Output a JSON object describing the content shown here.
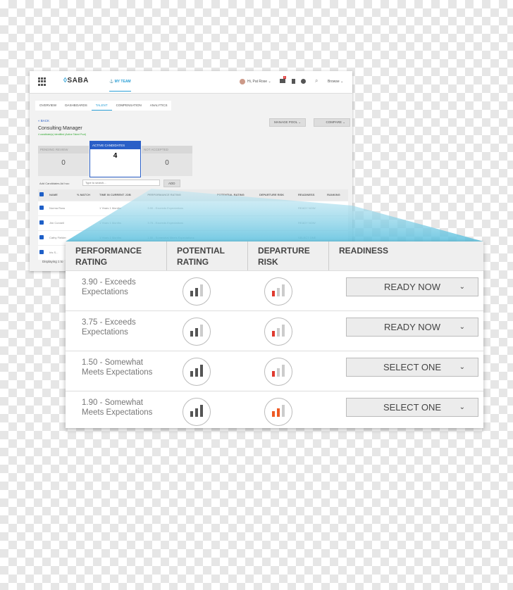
{
  "app": {
    "logo": "SABA",
    "nav_item": "MY TEAM",
    "user_greeting": "Hi, Pat Rose",
    "notification_count": "2",
    "browse": "Browse"
  },
  "tabs": [
    "OVERVIEW",
    "DASHBOARDS",
    "TALENT",
    "COMPENSATION",
    "ANALYTICS"
  ],
  "active_tab": "TALENT",
  "back": "« BACK",
  "title": "Consulting Manager",
  "subtitle": "4 candidate(s) identified (Active Talent Pool)",
  "manage_pool": "MANAGE POOL",
  "compare": "COMPARE",
  "cards": [
    {
      "label": "PENDING REVIEW",
      "count": "0"
    },
    {
      "label": "ACTIVE CANDIDATES",
      "count": "4"
    },
    {
      "label": "NOT ACCEPTED",
      "count": "0"
    }
  ],
  "add_label": "Add Candidates Ad hoc:",
  "search_placeholder": "Type to search...",
  "add_button": "ADD",
  "columns": [
    "NAME",
    "% MATCH",
    "TIME IN CURRENT JOB",
    "PERFORMANCE RATING",
    "POTENTIAL RATING",
    "DEPARTURE RISK",
    "READINESS",
    "RANKING"
  ],
  "rows": [
    {
      "name": "Norma Ross",
      "time": "1 Years 1 Months",
      "perf": "3.90 - Exceeds Expectations",
      "readiness": "READY NOW"
    },
    {
      "name": "Jim Connell",
      "time": "1 Years 1 Months",
      "perf": "3.75 - Exceeds Expectations",
      "readiness": "READY NOW"
    },
    {
      "name": "Cathy Fielder",
      "time": "1 Years 1 Months",
      "perf": "1.50 - Somewhat Meets Expectations",
      "readiness": "SELECT ONE"
    },
    {
      "name": "Iris S...",
      "time": "",
      "perf": "",
      "readiness": ""
    }
  ],
  "footer": "Displaying 1 to",
  "callout": {
    "headers": [
      "PERFORMANCE RATING",
      "POTENTIAL RATING",
      "DEPARTURE RISK",
      "READINESS"
    ],
    "rows": [
      {
        "perf": "3.90 - Exceeds Expectations",
        "potential_level": 2,
        "risk_level": 1,
        "risk_color": "#e03a2f",
        "readiness": "READY NOW"
      },
      {
        "perf": "3.75 - Exceeds Expectations",
        "potential_level": 2,
        "risk_level": 1,
        "risk_color": "#e03a2f",
        "readiness": "READY NOW"
      },
      {
        "perf": "1.50 - Somewhat Meets Expectations",
        "potential_level": 3,
        "risk_level": 1,
        "risk_color": "#e03a2f",
        "readiness": "SELECT ONE"
      },
      {
        "perf": "1.90 - Somewhat Meets Expectations",
        "potential_level": 3,
        "risk_level": 2,
        "risk_color": "#ee5a24",
        "readiness": "SELECT ONE"
      }
    ]
  },
  "colors": {
    "accent": "#2a9fd6",
    "checkbox": "#1e5fc7"
  }
}
